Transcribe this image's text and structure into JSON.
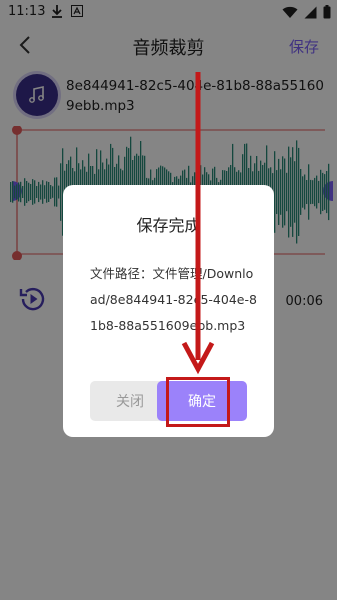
{
  "status_bar": {
    "time": "11:13",
    "icons": [
      "download-icon",
      "font-icon",
      "wifi-icon",
      "signal-icon",
      "battery-icon"
    ]
  },
  "app_bar": {
    "back_icon": "chevron-left-icon",
    "title": "音频裁剪",
    "save_label": "保存"
  },
  "file": {
    "icon": "music-note-icon",
    "name": "8e844941-82c5-404e-81b8-88a551609ebb.mp3"
  },
  "player": {
    "play_icon": "replay-icon",
    "duration": "00:06"
  },
  "dialog": {
    "title": "保存完成",
    "path_label": "文件路径：",
    "path_value": "文件管理/Download/8e844941-82c5-404e-81b8-88a551609ebb.mp3",
    "close_label": "关闭",
    "confirm_label": "确定"
  },
  "colors": {
    "accent": "#7b61f7",
    "wave": "#2a8b78",
    "handle": "#e25b5b",
    "annotation": "#c41919"
  }
}
